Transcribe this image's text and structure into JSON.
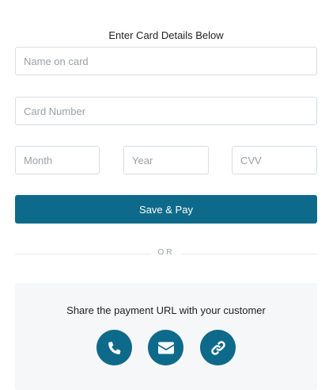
{
  "form": {
    "heading": "Enter Card Details Below",
    "name_placeholder": "Name on card",
    "card_placeholder": "Card Number",
    "month_placeholder": "Month",
    "year_placeholder": "Year",
    "cvv_placeholder": "CVV",
    "pay_label": "Save & Pay"
  },
  "divider": {
    "label": "OR"
  },
  "share": {
    "title": "Share the payment URL with your customer",
    "buttons": [
      {
        "icon": "phone-icon"
      },
      {
        "icon": "envelope-icon"
      },
      {
        "icon": "link-icon"
      }
    ]
  },
  "colors": {
    "accent": "#0e6a8a",
    "panel_bg": "#f6f7f9",
    "border": "#d9dde2"
  }
}
